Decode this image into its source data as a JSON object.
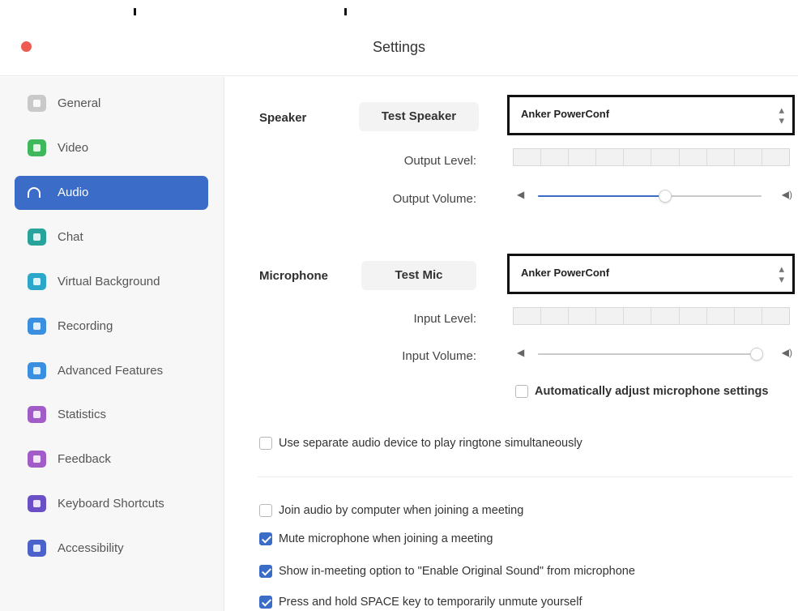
{
  "window": {
    "title": "Settings"
  },
  "sidebar": {
    "items": [
      {
        "label": "General",
        "icon": "gear-icon",
        "color": "#c9c9c9",
        "active": false
      },
      {
        "label": "Video",
        "icon": "video-camera-icon",
        "color": "#3fb85b",
        "active": false
      },
      {
        "label": "Audio",
        "icon": "headphones-icon",
        "color": "#3a6cc8",
        "active": true
      },
      {
        "label": "Chat",
        "icon": "chat-bubble-icon",
        "color": "#27a39b",
        "active": false
      },
      {
        "label": "Virtual Background",
        "icon": "person-portrait-icon",
        "color": "#2aa7c9",
        "active": false
      },
      {
        "label": "Recording",
        "icon": "record-circle-icon",
        "color": "#3a8fe0",
        "active": false
      },
      {
        "label": "Advanced Features",
        "icon": "sparkle-icon",
        "color": "#3a8fe0",
        "active": false
      },
      {
        "label": "Statistics",
        "icon": "bar-chart-icon",
        "color": "#a25cc7",
        "active": false
      },
      {
        "label": "Feedback",
        "icon": "smiley-face-icon",
        "color": "#a25cc7",
        "active": false
      },
      {
        "label": "Keyboard Shortcuts",
        "icon": "keyboard-icon",
        "color": "#6a4fc6",
        "active": false
      },
      {
        "label": "Accessibility",
        "icon": "accessibility-person-icon",
        "color": "#4a62c9",
        "active": false
      }
    ]
  },
  "speaker": {
    "label": "Speaker",
    "test_button": "Test Speaker",
    "device": "Anker PowerConf",
    "output_level_label": "Output Level:",
    "output_volume_label": "Output Volume:",
    "output_volume": 0.57
  },
  "microphone": {
    "label": "Microphone",
    "test_button": "Test Mic",
    "device": "Anker PowerConf",
    "input_level_label": "Input Level:",
    "input_volume_label": "Input Volume:",
    "input_volume": 0.98,
    "auto_adjust_label": "Automatically adjust microphone settings",
    "auto_adjust_checked": false
  },
  "options": [
    {
      "label": "Use separate audio device to play ringtone simultaneously",
      "checked": false
    },
    {
      "label": "Join audio by computer when joining a meeting",
      "checked": false
    },
    {
      "label": "Mute microphone when joining a meeting",
      "checked": true
    },
    {
      "label": "Show in-meeting option to \"Enable Original Sound\" from microphone",
      "checked": true
    },
    {
      "label": "Press and hold SPACE key to temporarily unmute yourself",
      "checked": true
    }
  ],
  "colors": {
    "accent": "#3a6cc8",
    "close": "#ee5a52"
  }
}
